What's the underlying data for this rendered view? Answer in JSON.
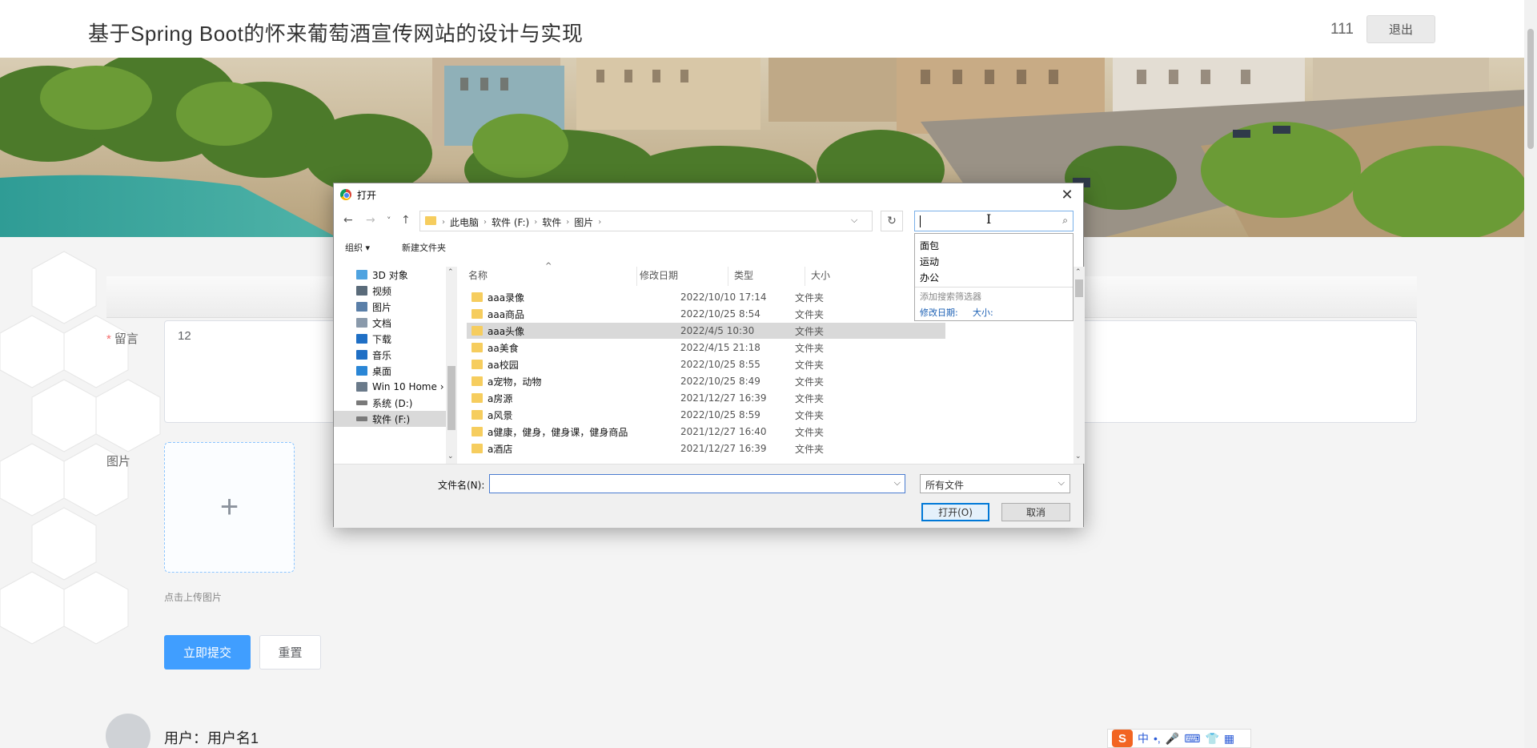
{
  "header": {
    "title": "基于Spring Boot的怀来葡萄酒宣传网站的设计与实现",
    "username": "111",
    "logout_label": "退出"
  },
  "form": {
    "message_label": "留言",
    "message_value": "12",
    "image_label": "图片",
    "upload_plus": "+",
    "upload_tip": "点击上传图片",
    "submit_label": "立即提交",
    "reset_label": "重置"
  },
  "comment": {
    "user_text": "用户：用户名1"
  },
  "ime": {
    "logo": "S",
    "mode": "中",
    "items": [
      "•,",
      "🎤",
      "⌨",
      "👕",
      "▦"
    ]
  },
  "dialog": {
    "title": "打开",
    "close": "✕",
    "nav": {
      "back": "←",
      "forward": "→",
      "recent": "˅",
      "up": "↑",
      "refresh": "↻"
    },
    "breadcrumbs": [
      "此电脑",
      "软件 (F:)",
      "软件",
      "图片"
    ],
    "search_placeholder": "",
    "organize_label": "组织 ▾",
    "new_folder_label": "新建文件夹",
    "tree": [
      {
        "label": "3D 对象",
        "color": "#4fa3e0"
      },
      {
        "label": "视频",
        "color": "#5a6b7a"
      },
      {
        "label": "图片",
        "color": "#5a7fa8"
      },
      {
        "label": "文档",
        "color": "#8a9aab"
      },
      {
        "label": "下载",
        "color": "#1f6fc5"
      },
      {
        "label": "音乐",
        "color": "#1f6fc5"
      },
      {
        "label": "桌面",
        "color": "#2a86d6"
      },
      {
        "label": "Win 10 Home ›",
        "color": "#6a7a8a"
      },
      {
        "label": "系统 (D:)",
        "color": "#7a7a7a"
      },
      {
        "label": "软件 (F:)",
        "color": "#7a7a7a",
        "selected": true
      }
    ],
    "columns": [
      "名称",
      "修改日期",
      "类型",
      "大小"
    ],
    "files": [
      {
        "name": "aaa录像",
        "date": "2022/10/10 17:14",
        "type": "文件夹"
      },
      {
        "name": "aaa商品",
        "date": "2022/10/25 8:54",
        "type": "文件夹"
      },
      {
        "name": "aaa头像",
        "date": "2022/4/5 10:30",
        "type": "文件夹",
        "selected": true
      },
      {
        "name": "aa美食",
        "date": "2022/4/15 21:18",
        "type": "文件夹"
      },
      {
        "name": "aa校园",
        "date": "2022/10/25 8:55",
        "type": "文件夹"
      },
      {
        "name": "a宠物，动物",
        "date": "2022/10/25 8:49",
        "type": "文件夹"
      },
      {
        "name": "a房源",
        "date": "2021/12/27 16:39",
        "type": "文件夹"
      },
      {
        "name": "a风景",
        "date": "2022/10/25 8:59",
        "type": "文件夹"
      },
      {
        "name": "a健康，健身，健身课，健身商品",
        "date": "2021/12/27 16:40",
        "type": "文件夹"
      },
      {
        "name": "a酒店",
        "date": "2021/12/27 16:39",
        "type": "文件夹"
      }
    ],
    "suggestions": [
      "面包",
      "运动",
      "办公"
    ],
    "add_filter_hint": "添加搜索筛选器",
    "filter_date": "修改日期:",
    "filter_size": "大小:",
    "filename_label": "文件名(N):",
    "filename_value": "",
    "filetype_value": "所有文件",
    "open_label": "打开(O)",
    "cancel_label": "取消"
  },
  "colors": {
    "primary": "#409eff",
    "required": "#f56c6c",
    "dialog_accent": "#0078d7",
    "folder": "#f6cd5e"
  }
}
